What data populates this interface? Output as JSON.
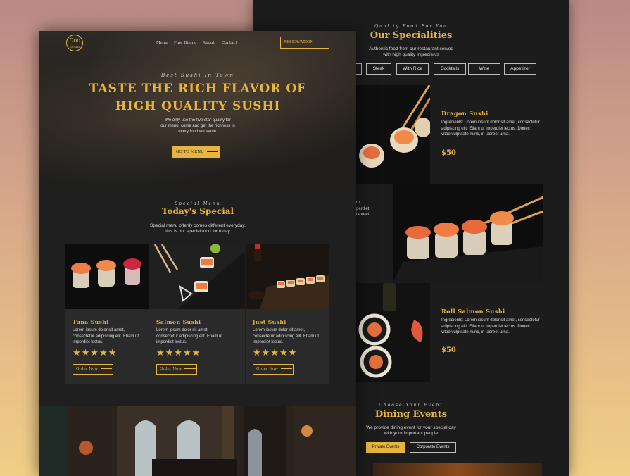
{
  "nav": {
    "logo_text": "Doo",
    "logo_sub": "SUSHI",
    "links": [
      "Menu",
      "Fine Dining",
      "About",
      "Contact"
    ],
    "reservation_label": "RESERVATION"
  },
  "hero": {
    "eyebrow": "Best Sushi In Town",
    "title_line1": "TASTE THE RICH FLAVOR OF",
    "title_line2": "HIGH QUALITY SUSHI",
    "text_line1": "We only use the five star quality for",
    "text_line2": "our menu, come and get the richness in",
    "text_line3": "every food we serve.",
    "cta_label": "GO TO MENU"
  },
  "today_special": {
    "eyebrow": "Special Menu",
    "title": "Today's Special",
    "text_line1": "Special menu oftenly comes different everyday,",
    "text_line2": "this is our special food for today",
    "cards": [
      {
        "title": "Tuna Sushi",
        "desc": "Lorem ipsum dolor sit amet, consectetur adipiscing elit. Etiam ut imperdiet lectus.",
        "stars": "★★★★★",
        "order_label": "Order Now"
      },
      {
        "title": "Salmon Sushi",
        "desc": "Lorem ipsum dolor sit amet, consectetur adipiscing elit. Etiam ut imperdiet lectus.",
        "stars": "★★★★★",
        "order_label": "Order Now"
      },
      {
        "title": "Just Sushi",
        "desc": "Lorem ipsum dolor sit amet, consectetur adipiscing elit. Etiam ut imperdiet lectus.",
        "stars": "★★★★★",
        "order_label": "Order Now"
      }
    ]
  },
  "specialities": {
    "eyebrow": "Quality Food For You",
    "title": "Our Specialities",
    "text_line1": "Authentic food from our restaurant served",
    "text_line2": "with high quality ingredients",
    "tabs": [
      "N",
      "Steak",
      "With Rice",
      "Cocktails",
      "Wine",
      "Appetizer"
    ],
    "dishes": [
      {
        "title": "Dragon Sushi",
        "desc": "Ingredients: Lorem ipsum dolor sit amet, consectetur adipiscing elit. Etiam ut imperdiet lectus. Donec vitae vulputate nunc, in laoreet urna.",
        "price": "$50"
      },
      {
        "title": "Roll Salmon Sushi",
        "desc": "Ingredients: Lorem ipsum dolor sit amet, consectetur adipiscing elit. Etiam ut imperdiet lectus. Donec vitae vulputate nunc, in laoreet urna.",
        "price": "$50"
      }
    ],
    "partial_text": [
      "m,",
      "perdiet",
      "laoreet"
    ]
  },
  "dining_events": {
    "eyebrow": "Choose Your Event",
    "title": "Dining Events",
    "text_line1": "We provide dining event for your special day",
    "text_line2": "with your important people",
    "buttons": [
      "Private Events",
      "Corporate Events"
    ]
  }
}
